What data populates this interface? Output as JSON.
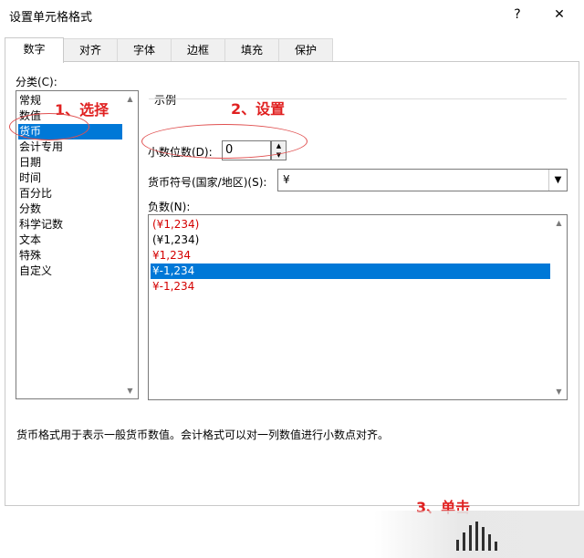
{
  "window": {
    "title": "设置单元格格式",
    "help_label": "?",
    "close_label": "✕"
  },
  "tabs": [
    {
      "label": "数字",
      "active": true
    },
    {
      "label": "对齐"
    },
    {
      "label": "字体"
    },
    {
      "label": "边框"
    },
    {
      "label": "填充"
    },
    {
      "label": "保护"
    }
  ],
  "category": {
    "label": "分类(C):",
    "items": [
      "常规",
      "数值",
      "货币",
      "会计专用",
      "日期",
      "时间",
      "百分比",
      "分数",
      "科学记数",
      "文本",
      "特殊",
      "自定义"
    ],
    "selected": "货币"
  },
  "sample": {
    "label": "示例",
    "value": ""
  },
  "decimal": {
    "label": "小数位数(D):",
    "value": "0"
  },
  "currency_symbol": {
    "label": "货币符号(国家/地区)(S):",
    "value": "¥"
  },
  "negative": {
    "label": "负数(N):",
    "items": [
      {
        "text": "(¥1,234)",
        "color": "#d40000"
      },
      {
        "text": "(¥1,234)",
        "color": "#000000"
      },
      {
        "text": "¥1,234",
        "color": "#d40000"
      },
      {
        "text": "¥-1,234",
        "color": "#000000",
        "selected": true
      },
      {
        "text": "¥-1,234",
        "color": "#d40000"
      }
    ]
  },
  "description": "货币格式用于表示一般货币数值。会计格式可以对一列数值进行小数点对齐。",
  "annotations": {
    "step1": "1、选择",
    "step2": "2、设置",
    "step3": "3、单击"
  },
  "colors": {
    "selection": "#0078d7",
    "negative_red": "#d40000",
    "annotation_red": "#e02020"
  }
}
